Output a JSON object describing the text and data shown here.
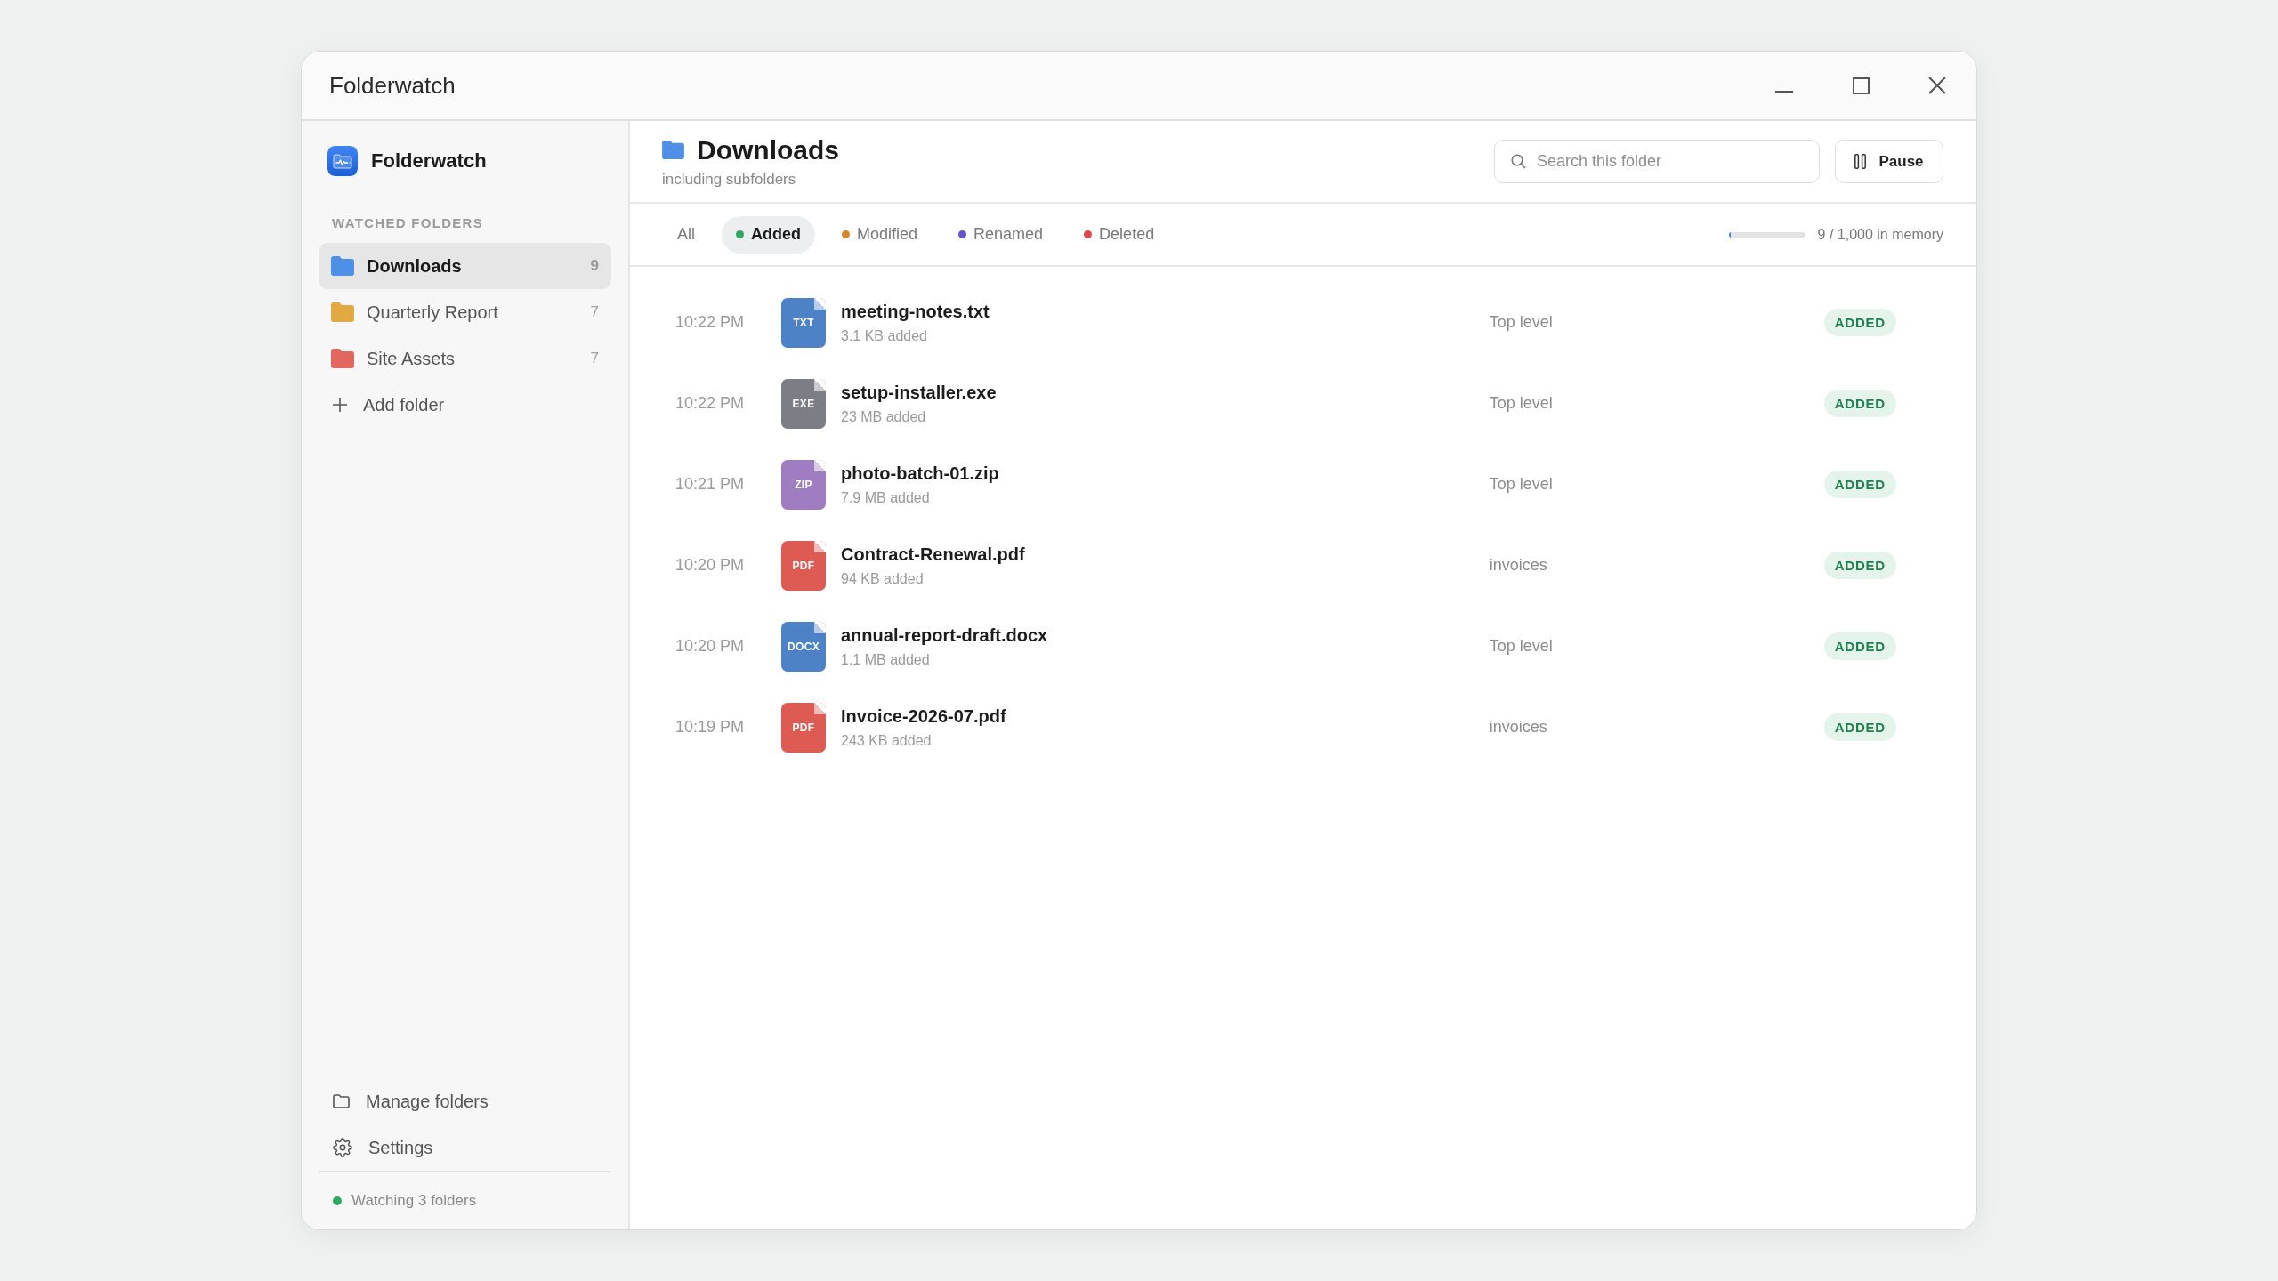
{
  "window": {
    "title": "Folderwatch"
  },
  "sidebar": {
    "app_name": "Folderwatch",
    "section_heading": "WATCHED FOLDERS",
    "folders": [
      {
        "name": "Downloads",
        "count": "9",
        "color": "#4d90e6",
        "selected": true
      },
      {
        "name": "Quarterly Report",
        "count": "7",
        "color": "#e2a942",
        "selected": false
      },
      {
        "name": "Site Assets",
        "count": "7",
        "color": "#e2685f",
        "selected": false
      }
    ],
    "add_folder": "Add folder",
    "footer_items": [
      {
        "kind": "folders",
        "label": "Manage folders"
      },
      {
        "kind": "settings",
        "label": "Settings"
      }
    ],
    "status": {
      "text": "Watching 3 folders",
      "active": true
    }
  },
  "header": {
    "title": "Downloads",
    "subtitle": "including subfolders",
    "search": {
      "placeholder": "Search this folder"
    },
    "pause_button": "Pause"
  },
  "filters": [
    {
      "label": "All",
      "selected": false
    },
    {
      "label": "Added",
      "color": "#2fa866",
      "selected": true
    },
    {
      "label": "Modified",
      "color": "#d4862c",
      "selected": false
    },
    {
      "label": "Renamed",
      "color": "#6654c8",
      "selected": false
    },
    {
      "label": "Deleted",
      "color": "#e2474a",
      "selected": false
    }
  ],
  "memory": {
    "level": 0.03,
    "reading": "9 / 1,000 in memory"
  },
  "events": [
    {
      "time": "10:22 PM",
      "type_label": "TXT",
      "color": "#4d82c7",
      "name": "meeting-notes.txt",
      "detail": "3.1 KB added",
      "location": "Top level",
      "status": "ADDED"
    },
    {
      "time": "10:22 PM",
      "type_label": "EXE",
      "color": "#7b7e85",
      "name": "setup-installer.exe",
      "detail": "23 MB added",
      "location": "Top level",
      "status": "ADDED"
    },
    {
      "time": "10:21 PM",
      "type_label": "ZIP",
      "color": "#a07dc0",
      "name": "photo-batch-01.zip",
      "detail": "7.9 MB added",
      "location": "Top level",
      "status": "ADDED"
    },
    {
      "time": "10:20 PM",
      "type_label": "PDF",
      "color": "#dd5b53",
      "name": "Contract-Renewal.pdf",
      "detail": "94 KB added",
      "location": "invoices",
      "status": "ADDED"
    },
    {
      "time": "10:20 PM",
      "type_label": "DOCX",
      "color": "#4d82c7",
      "name": "annual-report-draft.docx",
      "detail": "1.1 MB added",
      "location": "Top level",
      "status": "ADDED"
    },
    {
      "time": "10:19 PM",
      "type_label": "PDF",
      "color": "#dd5b53",
      "name": "Invoice-2026-07.pdf",
      "detail": "243 KB added",
      "location": "invoices",
      "status": "ADDED"
    }
  ]
}
